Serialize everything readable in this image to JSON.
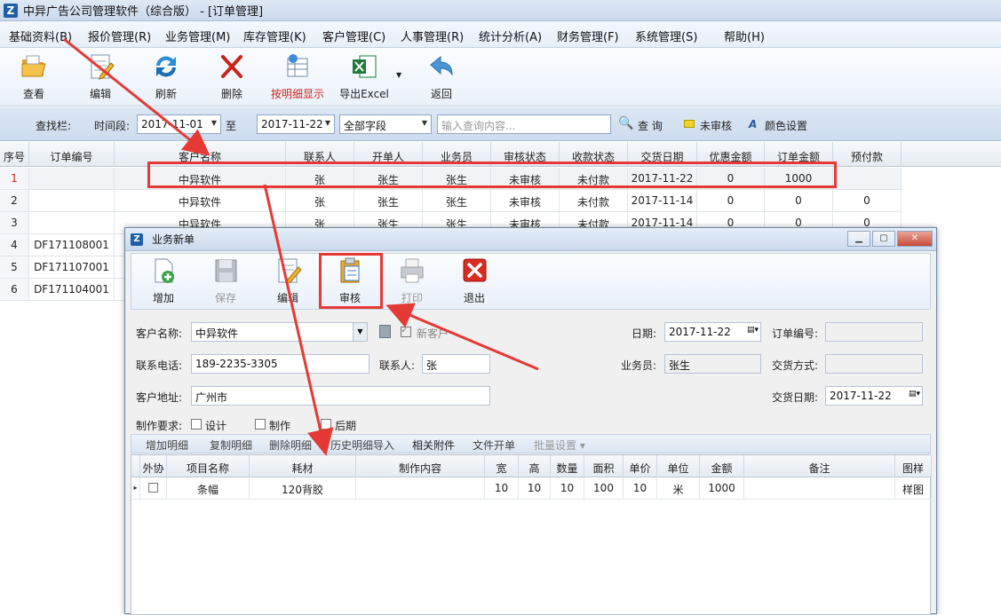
{
  "window": {
    "title": "中异广告公司管理软件（综合版） - [订单管理]",
    "icon": "Z"
  },
  "menu": [
    "基础资料(B)",
    "报价管理(R)",
    "业务管理(M)",
    "库存管理(K)",
    "客户管理(C)",
    "人事管理(R)",
    "统计分析(A)",
    "财务管理(F)",
    "系统管理(S)",
    "帮助(H)"
  ],
  "toolbar": {
    "view": "查看",
    "edit": "编辑",
    "refresh": "刷新",
    "delete": "删除",
    "detail_display": "按明细显示",
    "export_excel": "导出Excel",
    "back": "返回"
  },
  "search": {
    "label": "查找栏:",
    "period_label": "时间段:",
    "date_from": "2017-11-01",
    "to": "至",
    "date_to": "2017-11-22",
    "field": "全部字段",
    "query_placeholder": "输入查询内容...",
    "query_button": "查 询",
    "unreviewed": "未审核",
    "color_settings": "颜色设置"
  },
  "grid": {
    "headers": [
      "序号",
      "订单编号",
      "客户名称",
      "联系人",
      "开单人",
      "业务员",
      "审核状态",
      "收款状态",
      "交货日期",
      "优惠金额",
      "订单金额",
      "预付款"
    ],
    "rows": [
      [
        "1",
        "",
        "中异软件",
        "张",
        "张生",
        "张生",
        "未审核",
        "未付款",
        "2017-11-22",
        "0",
        "1000",
        ""
      ],
      [
        "2",
        "",
        "中异软件",
        "张",
        "张生",
        "张生",
        "未审核",
        "未付款",
        "2017-11-14",
        "0",
        "0",
        "0"
      ],
      [
        "3",
        "",
        "中异软件",
        "张",
        "张生",
        "张生",
        "未审核",
        "未付款",
        "2017-11-14",
        "0",
        "0",
        "0"
      ],
      [
        "4",
        "DF171108001",
        "",
        "",
        "",
        "",
        "",
        "",
        "",
        "",
        "",
        ""
      ],
      [
        "5",
        "DF171107001",
        "",
        "",
        "",
        "",
        "",
        "",
        "",
        "",
        "",
        ""
      ],
      [
        "6",
        "DF171104001",
        "",
        "",
        "",
        "",
        "",
        "",
        "",
        "",
        "",
        ""
      ]
    ]
  },
  "dialog": {
    "title": "业务新单",
    "toolbar": {
      "add": "增加",
      "save": "保存",
      "edit": "编辑",
      "review": "审核",
      "print": "打印",
      "exit": "退出"
    },
    "form": {
      "customer_label": "客户名称:",
      "customer": "中异软件",
      "new_customer": "新客户",
      "date_label": "日期:",
      "date": "2017-11-22",
      "order_no_label": "订单编号:",
      "order_no": "",
      "phone_label": "联系电话:",
      "phone": "189-2235-3305",
      "contact_label": "联系人:",
      "contact": "张",
      "salesman_label": "业务员:",
      "salesman": "张生",
      "delivery_method_label": "交货方式:",
      "delivery_method": "",
      "address_label": "客户地址:",
      "address": "广州市",
      "delivery_date_label": "交货日期:",
      "delivery_date": "2017-11-22",
      "requirement_label": "制作要求:",
      "req_design": "设计",
      "req_make": "制作",
      "req_post": "后期"
    },
    "subtoolbar": [
      "增加明细",
      "复制明细",
      "删除明细",
      "历史明细导入",
      "相关附件",
      "文件开单",
      "批量设置 ▾"
    ],
    "detail_headers": [
      "外协",
      "项目名称",
      "耗材",
      "制作内容",
      "宽",
      "高",
      "数量",
      "面积",
      "单价",
      "单位",
      "金额",
      "备注",
      "图样"
    ],
    "detail_rows": [
      [
        "",
        "条幅",
        "120背胶",
        "",
        "10",
        "10",
        "10",
        "100",
        "10",
        "米",
        "1000",
        "",
        "样图"
      ]
    ]
  }
}
